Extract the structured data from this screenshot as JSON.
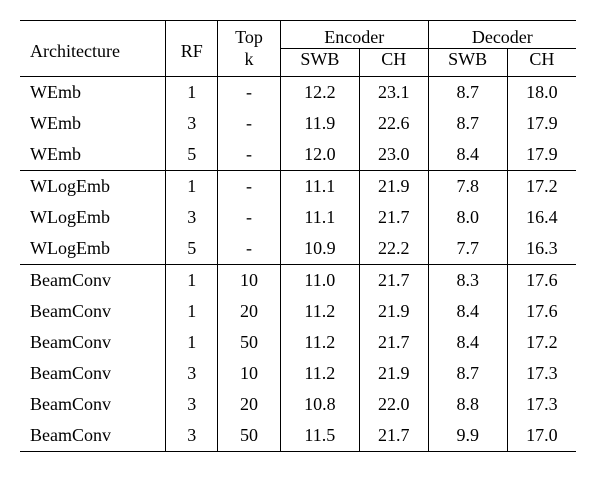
{
  "header": {
    "architecture": "Architecture",
    "rf": "RF",
    "top": "Top",
    "k": "k",
    "encoder": "Encoder",
    "decoder": "Decoder",
    "swb": "SWB",
    "ch": "CH"
  },
  "groups": [
    {
      "rows": [
        {
          "arch": "WEmb",
          "rf": "1",
          "topk": "-",
          "enc_swb": "12.2",
          "enc_ch": "23.1",
          "dec_swb": "8.7",
          "dec_ch": "18.0"
        },
        {
          "arch": "WEmb",
          "rf": "3",
          "topk": "-",
          "enc_swb": "11.9",
          "enc_ch": "22.6",
          "dec_swb": "8.7",
          "dec_ch": "17.9"
        },
        {
          "arch": "WEmb",
          "rf": "5",
          "topk": "-",
          "enc_swb": "12.0",
          "enc_ch": "23.0",
          "dec_swb": "8.4",
          "dec_ch": "17.9"
        }
      ]
    },
    {
      "rows": [
        {
          "arch": "WLogEmb",
          "rf": "1",
          "topk": "-",
          "enc_swb": "11.1",
          "enc_ch": "21.9",
          "dec_swb": "7.8",
          "dec_ch": "17.2"
        },
        {
          "arch": "WLogEmb",
          "rf": "3",
          "topk": "-",
          "enc_swb": "11.1",
          "enc_ch": "21.7",
          "dec_swb": "8.0",
          "dec_ch": "16.4"
        },
        {
          "arch": "WLogEmb",
          "rf": "5",
          "topk": "-",
          "enc_swb": "10.9",
          "enc_ch": "22.2",
          "dec_swb": "7.7",
          "dec_ch": "16.3"
        }
      ]
    },
    {
      "rows": [
        {
          "arch": "BeamConv",
          "rf": "1",
          "topk": "10",
          "enc_swb": "11.0",
          "enc_ch": "21.7",
          "dec_swb": "8.3",
          "dec_ch": "17.6"
        },
        {
          "arch": "BeamConv",
          "rf": "1",
          "topk": "20",
          "enc_swb": "11.2",
          "enc_ch": "21.9",
          "dec_swb": "8.4",
          "dec_ch": "17.6"
        },
        {
          "arch": "BeamConv",
          "rf": "1",
          "topk": "50",
          "enc_swb": "11.2",
          "enc_ch": "21.7",
          "dec_swb": "8.4",
          "dec_ch": "17.2"
        },
        {
          "arch": "BeamConv",
          "rf": "3",
          "topk": "10",
          "enc_swb": "11.2",
          "enc_ch": "21.9",
          "dec_swb": "8.7",
          "dec_ch": "17.3"
        },
        {
          "arch": "BeamConv",
          "rf": "3",
          "topk": "20",
          "enc_swb": "10.8",
          "enc_ch": "22.0",
          "dec_swb": "8.8",
          "dec_ch": "17.3"
        },
        {
          "arch": "BeamConv",
          "rf": "3",
          "topk": "50",
          "enc_swb": "11.5",
          "enc_ch": "21.7",
          "dec_swb": "9.9",
          "dec_ch": "17.0"
        }
      ]
    }
  ],
  "chart_data": {
    "type": "table",
    "columns": [
      "Architecture",
      "RF",
      "Top k",
      "Encoder SWB",
      "Encoder CH",
      "Decoder SWB",
      "Decoder CH"
    ],
    "rows": [
      [
        "WEmb",
        1,
        null,
        12.2,
        23.1,
        8.7,
        18.0
      ],
      [
        "WEmb",
        3,
        null,
        11.9,
        22.6,
        8.7,
        17.9
      ],
      [
        "WEmb",
        5,
        null,
        12.0,
        23.0,
        8.4,
        17.9
      ],
      [
        "WLogEmb",
        1,
        null,
        11.1,
        21.9,
        7.8,
        17.2
      ],
      [
        "WLogEmb",
        3,
        null,
        11.1,
        21.7,
        8.0,
        16.4
      ],
      [
        "WLogEmb",
        5,
        null,
        10.9,
        22.2,
        7.7,
        16.3
      ],
      [
        "BeamConv",
        1,
        10,
        11.0,
        21.7,
        8.3,
        17.6
      ],
      [
        "BeamConv",
        1,
        20,
        11.2,
        21.9,
        8.4,
        17.6
      ],
      [
        "BeamConv",
        1,
        50,
        11.2,
        21.7,
        8.4,
        17.2
      ],
      [
        "BeamConv",
        3,
        10,
        11.2,
        21.9,
        8.7,
        17.3
      ],
      [
        "BeamConv",
        3,
        20,
        10.8,
        22.0,
        8.8,
        17.3
      ],
      [
        "BeamConv",
        3,
        50,
        11.5,
        21.7,
        9.9,
        17.0
      ]
    ]
  }
}
